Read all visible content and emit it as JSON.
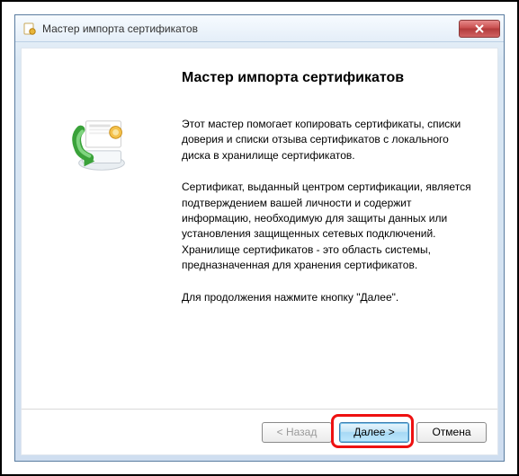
{
  "window": {
    "title": "Мастер импорта сертификатов"
  },
  "wizard": {
    "heading": "Мастер импорта сертификатов",
    "para1": "Этот мастер помогает копировать сертификаты, списки доверия и списки отзыва сертификатов с локального диска в хранилище сертификатов.",
    "para2": "Сертификат, выданный центром сертификации, является подтверждением вашей личности и содержит информацию, необходимую для защиты данных или установления защищенных сетевых подключений. Хранилище сертификатов - это область системы, предназначенная для хранения сертификатов.",
    "para3": "Для продолжения нажмите кнопку \"Далее\"."
  },
  "buttons": {
    "back": "< Назад",
    "next": "Далее >",
    "cancel": "Отмена"
  }
}
